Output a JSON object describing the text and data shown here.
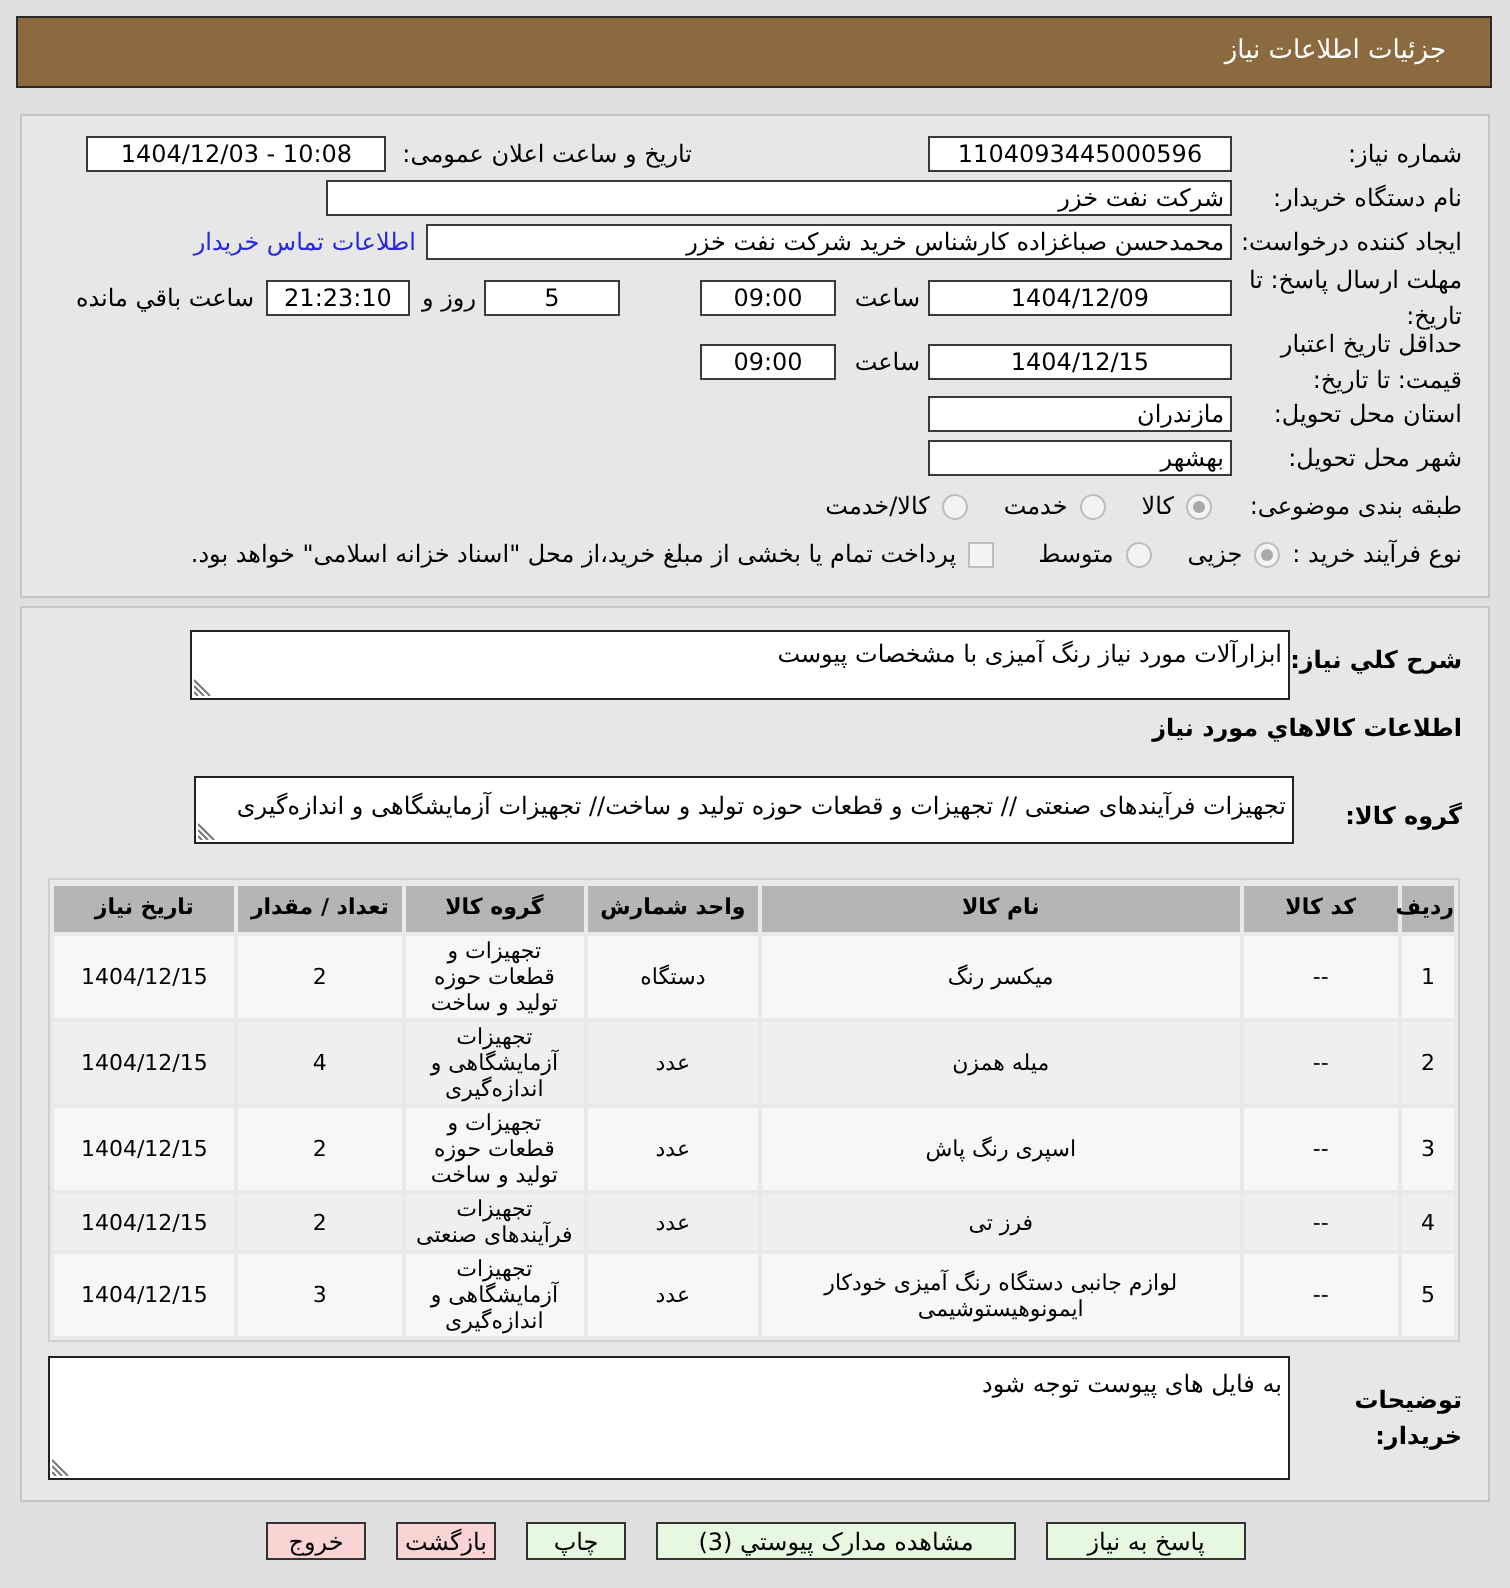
{
  "header": {
    "title": "جزئیات اطلاعات نیاز"
  },
  "details": {
    "need_number": {
      "label": "شماره نیاز:",
      "value": "1104093445000596"
    },
    "announce": {
      "label": "تاریخ و ساعت اعلان عمومی:",
      "value": "1404/12/03 - 10:08"
    },
    "buyer_org": {
      "label": "نام دستگاه خریدار:",
      "value": "شرکت نفت خزر"
    },
    "creator": {
      "label": "ایجاد کننده درخواست:",
      "value": "محمدحسن صباغزاده کارشناس خرید شرکت نفت خزر",
      "link": "اطلاعات تماس خریدار"
    },
    "deadline": {
      "label": "مهلت ارسال پاسخ: تا تاریخ:",
      "date": "1404/12/09",
      "time_label": "ساعت",
      "time": "09:00",
      "days": "5",
      "days_label": "روز و",
      "remaining": "21:23:10",
      "remaining_label": "ساعت باقي مانده"
    },
    "validity": {
      "label": "حداقل تاریخ اعتبار قیمت: تا تاریخ:",
      "date": "1404/12/15",
      "time_label": "ساعت",
      "time": "09:00"
    },
    "province": {
      "label": "استان محل تحویل:",
      "value": "مازندران"
    },
    "city": {
      "label": "شهر محل تحویل:",
      "value": "بهشهر"
    },
    "category": {
      "label": "طبقه بندی موضوعی:",
      "options": [
        {
          "label": "کالا",
          "selected": true
        },
        {
          "label": "خدمت",
          "selected": false
        },
        {
          "label": "کالا/خدمت",
          "selected": false
        }
      ]
    },
    "process": {
      "label": "نوع فرآیند خرید :",
      "options": [
        {
          "label": "جزیی",
          "selected": true
        },
        {
          "label": "متوسط",
          "selected": false
        }
      ],
      "treasury": {
        "label": "پرداخت تمام یا بخشی از مبلغ خرید،از محل \"اسناد خزانه اسلامی\" خواهد بود.",
        "checked": false
      }
    }
  },
  "description": {
    "label": "شرح کلي نیاز:",
    "value": "ابزارآلات مورد نیاز رنگ آمیزی با مشخصات پیوست"
  },
  "goods_title": "اطلاعات کالاهاي مورد نیاز",
  "goods_group": {
    "label": "گروه کالا:",
    "value": "تجهیزات فرآیندهای صنعتی // تجهیزات و قطعات حوزه تولید و ساخت// تجهیزات آزمایشگاهی و اندازه‌گیری"
  },
  "table": {
    "columns": [
      "ردیف",
      "کد کالا",
      "نام کالا",
      "واحد شمارش",
      "گروه کالا",
      "تعداد / مقدار",
      "تاریخ نیاز"
    ],
    "rows": [
      [
        "1",
        "--",
        "میکسر رنگ",
        "دستگاه",
        "تجهیزات و قطعات حوزه تولید و ساخت",
        "2",
        "1404/12/15"
      ],
      [
        "2",
        "--",
        "میله همزن",
        "عدد",
        "تجهیزات آزمایشگاهی و اندازه‌گیری",
        "4",
        "1404/12/15"
      ],
      [
        "3",
        "--",
        "اسپری رنگ پاش",
        "عدد",
        "تجهیزات و قطعات حوزه تولید و ساخت",
        "2",
        "1404/12/15"
      ],
      [
        "4",
        "--",
        "فرز تی",
        "عدد",
        "تجهیزات فرآیندهای صنعتی",
        "2",
        "1404/12/15"
      ],
      [
        "5",
        "--",
        "لوازم جانبی دستگاه رنگ آمیزی خودکار ایمونوهیستوشیمی",
        "عدد",
        "تجهیزات آزمایشگاهی و اندازه‌گیری",
        "3",
        "1404/12/15"
      ]
    ]
  },
  "buyer_notes": {
    "label": "توضیحات خریدار:",
    "value": "به فایل های پیوست توجه شود"
  },
  "buttons": [
    {
      "label": "پاسخ به نیاز",
      "kind": "action"
    },
    {
      "label": "مشاهده مدارک پیوستي (3)",
      "kind": "action"
    },
    {
      "label": "چاپ",
      "kind": "action"
    },
    {
      "label": "بازگشت",
      "kind": "exit"
    },
    {
      "label": "خروج",
      "kind": "exit"
    }
  ]
}
